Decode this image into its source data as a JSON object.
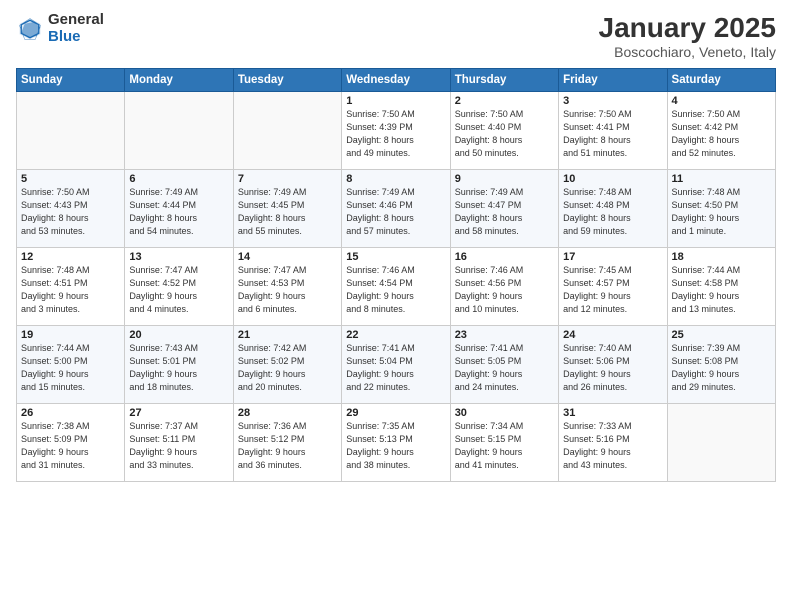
{
  "logo": {
    "general": "General",
    "blue": "Blue"
  },
  "header": {
    "month": "January 2025",
    "location": "Boscochiaro, Veneto, Italy"
  },
  "weekdays": [
    "Sunday",
    "Monday",
    "Tuesday",
    "Wednesday",
    "Thursday",
    "Friday",
    "Saturday"
  ],
  "weeks": [
    [
      {
        "day": "",
        "info": ""
      },
      {
        "day": "",
        "info": ""
      },
      {
        "day": "",
        "info": ""
      },
      {
        "day": "1",
        "info": "Sunrise: 7:50 AM\nSunset: 4:39 PM\nDaylight: 8 hours\nand 49 minutes."
      },
      {
        "day": "2",
        "info": "Sunrise: 7:50 AM\nSunset: 4:40 PM\nDaylight: 8 hours\nand 50 minutes."
      },
      {
        "day": "3",
        "info": "Sunrise: 7:50 AM\nSunset: 4:41 PM\nDaylight: 8 hours\nand 51 minutes."
      },
      {
        "day": "4",
        "info": "Sunrise: 7:50 AM\nSunset: 4:42 PM\nDaylight: 8 hours\nand 52 minutes."
      }
    ],
    [
      {
        "day": "5",
        "info": "Sunrise: 7:50 AM\nSunset: 4:43 PM\nDaylight: 8 hours\nand 53 minutes."
      },
      {
        "day": "6",
        "info": "Sunrise: 7:49 AM\nSunset: 4:44 PM\nDaylight: 8 hours\nand 54 minutes."
      },
      {
        "day": "7",
        "info": "Sunrise: 7:49 AM\nSunset: 4:45 PM\nDaylight: 8 hours\nand 55 minutes."
      },
      {
        "day": "8",
        "info": "Sunrise: 7:49 AM\nSunset: 4:46 PM\nDaylight: 8 hours\nand 57 minutes."
      },
      {
        "day": "9",
        "info": "Sunrise: 7:49 AM\nSunset: 4:47 PM\nDaylight: 8 hours\nand 58 minutes."
      },
      {
        "day": "10",
        "info": "Sunrise: 7:48 AM\nSunset: 4:48 PM\nDaylight: 8 hours\nand 59 minutes."
      },
      {
        "day": "11",
        "info": "Sunrise: 7:48 AM\nSunset: 4:50 PM\nDaylight: 9 hours\nand 1 minute."
      }
    ],
    [
      {
        "day": "12",
        "info": "Sunrise: 7:48 AM\nSunset: 4:51 PM\nDaylight: 9 hours\nand 3 minutes."
      },
      {
        "day": "13",
        "info": "Sunrise: 7:47 AM\nSunset: 4:52 PM\nDaylight: 9 hours\nand 4 minutes."
      },
      {
        "day": "14",
        "info": "Sunrise: 7:47 AM\nSunset: 4:53 PM\nDaylight: 9 hours\nand 6 minutes."
      },
      {
        "day": "15",
        "info": "Sunrise: 7:46 AM\nSunset: 4:54 PM\nDaylight: 9 hours\nand 8 minutes."
      },
      {
        "day": "16",
        "info": "Sunrise: 7:46 AM\nSunset: 4:56 PM\nDaylight: 9 hours\nand 10 minutes."
      },
      {
        "day": "17",
        "info": "Sunrise: 7:45 AM\nSunset: 4:57 PM\nDaylight: 9 hours\nand 12 minutes."
      },
      {
        "day": "18",
        "info": "Sunrise: 7:44 AM\nSunset: 4:58 PM\nDaylight: 9 hours\nand 13 minutes."
      }
    ],
    [
      {
        "day": "19",
        "info": "Sunrise: 7:44 AM\nSunset: 5:00 PM\nDaylight: 9 hours\nand 15 minutes."
      },
      {
        "day": "20",
        "info": "Sunrise: 7:43 AM\nSunset: 5:01 PM\nDaylight: 9 hours\nand 18 minutes."
      },
      {
        "day": "21",
        "info": "Sunrise: 7:42 AM\nSunset: 5:02 PM\nDaylight: 9 hours\nand 20 minutes."
      },
      {
        "day": "22",
        "info": "Sunrise: 7:41 AM\nSunset: 5:04 PM\nDaylight: 9 hours\nand 22 minutes."
      },
      {
        "day": "23",
        "info": "Sunrise: 7:41 AM\nSunset: 5:05 PM\nDaylight: 9 hours\nand 24 minutes."
      },
      {
        "day": "24",
        "info": "Sunrise: 7:40 AM\nSunset: 5:06 PM\nDaylight: 9 hours\nand 26 minutes."
      },
      {
        "day": "25",
        "info": "Sunrise: 7:39 AM\nSunset: 5:08 PM\nDaylight: 9 hours\nand 29 minutes."
      }
    ],
    [
      {
        "day": "26",
        "info": "Sunrise: 7:38 AM\nSunset: 5:09 PM\nDaylight: 9 hours\nand 31 minutes."
      },
      {
        "day": "27",
        "info": "Sunrise: 7:37 AM\nSunset: 5:11 PM\nDaylight: 9 hours\nand 33 minutes."
      },
      {
        "day": "28",
        "info": "Sunrise: 7:36 AM\nSunset: 5:12 PM\nDaylight: 9 hours\nand 36 minutes."
      },
      {
        "day": "29",
        "info": "Sunrise: 7:35 AM\nSunset: 5:13 PM\nDaylight: 9 hours\nand 38 minutes."
      },
      {
        "day": "30",
        "info": "Sunrise: 7:34 AM\nSunset: 5:15 PM\nDaylight: 9 hours\nand 41 minutes."
      },
      {
        "day": "31",
        "info": "Sunrise: 7:33 AM\nSunset: 5:16 PM\nDaylight: 9 hours\nand 43 minutes."
      },
      {
        "day": "",
        "info": ""
      }
    ]
  ]
}
